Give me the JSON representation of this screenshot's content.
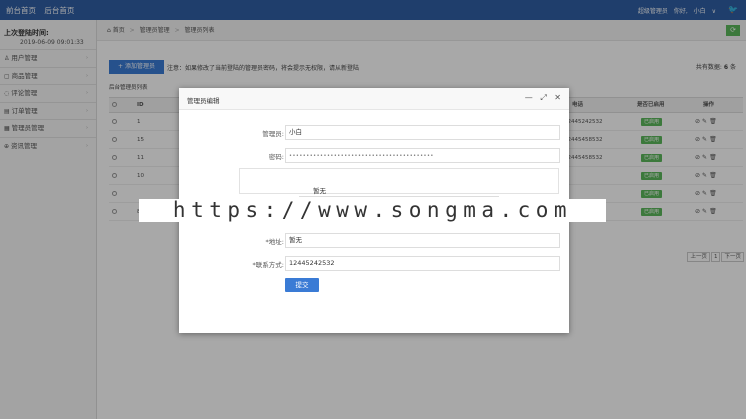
{
  "topbar": {
    "link_front": "前台首页",
    "link_back": "后台首页",
    "role": "超级管理员",
    "greeting": "你好,",
    "user": "小白",
    "caret": "∨"
  },
  "sidebar": {
    "last_login_label": "上次登陆时间:",
    "last_login_time": "2019-06-09 09:01:33",
    "items": [
      {
        "label": "用户管理",
        "icon": "user-icon"
      },
      {
        "label": "商品管理",
        "icon": "goods-icon"
      },
      {
        "label": "评论管理",
        "icon": "comment-icon"
      },
      {
        "label": "订单管理",
        "icon": "order-icon"
      },
      {
        "label": "管理员管理",
        "icon": "admin-icon"
      },
      {
        "label": "资讯管理",
        "icon": "news-icon"
      }
    ]
  },
  "breadcrumb": {
    "home": "首页",
    "level1": "管理员管理",
    "level2": "管理员列表"
  },
  "toolbar": {
    "add_label": "+ 添加管理员",
    "notice": "注意：如果修改了当前登陆的管理员密码，将会提示无权限，请从新登陆",
    "total_label": "共有数据:",
    "total_count": "6",
    "total_unit": "条"
  },
  "table": {
    "caption": "后台管理员列表",
    "headers": {
      "id": "ID",
      "phone": "电话",
      "enabled": "是否已启用",
      "ops": "操作"
    },
    "rows": [
      {
        "id": "1",
        "phone": "12445242532",
        "enabled": "已启用"
      },
      {
        "id": "15",
        "phone": "12445458532",
        "enabled": "已启用"
      },
      {
        "id": "11",
        "phone": "12445458532",
        "enabled": "已启用"
      },
      {
        "id": "10",
        "phone": "",
        "enabled": "已启用"
      },
      {
        "id": "",
        "phone": "",
        "enabled": "已启用"
      },
      {
        "id": "8",
        "phone": "",
        "enabled": "已启用"
      }
    ]
  },
  "pagination": {
    "prev": "上一页",
    "page": "1",
    "next": "下一页"
  },
  "modal": {
    "title": "管理员编辑",
    "minimize": "—",
    "maximize": "⤢",
    "close": "✕",
    "fields": {
      "admin_label": "管理员:",
      "admin_value": "小白",
      "password_label": "密码:",
      "address_label": "*地址:",
      "address_value": "暂无",
      "contact_label": "*联系方式:",
      "contact_value": "12445242532"
    },
    "dropdown_option": "暂无",
    "submit": "提交"
  },
  "watermark": "https://www.songma.com",
  "colors": {
    "topbar": "#2f5fa4",
    "primary": "#3a7bd5",
    "success": "#5cb85c"
  }
}
